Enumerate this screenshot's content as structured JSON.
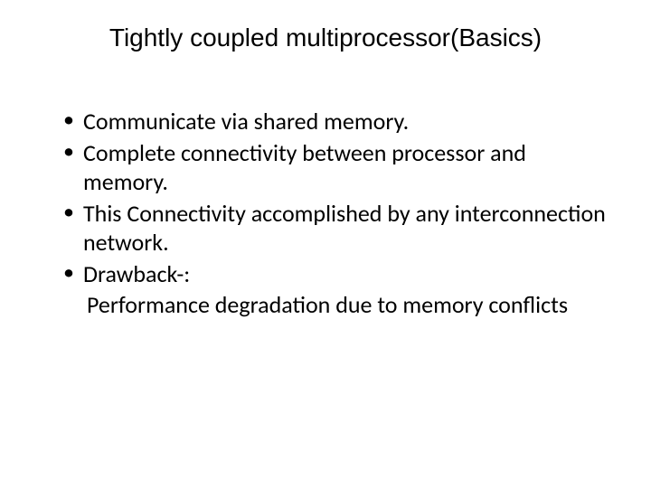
{
  "title": "Tightly coupled multiprocessor(Basics)",
  "bullets": {
    "b0": "Communicate via shared memory.",
    "b1": "Complete connectivity between processor and memory.",
    "b2": "This Connectivity accomplished by any interconnection network.",
    "b3": "Drawback-:"
  },
  "sub": "Performance degradation due to memory conflicts"
}
